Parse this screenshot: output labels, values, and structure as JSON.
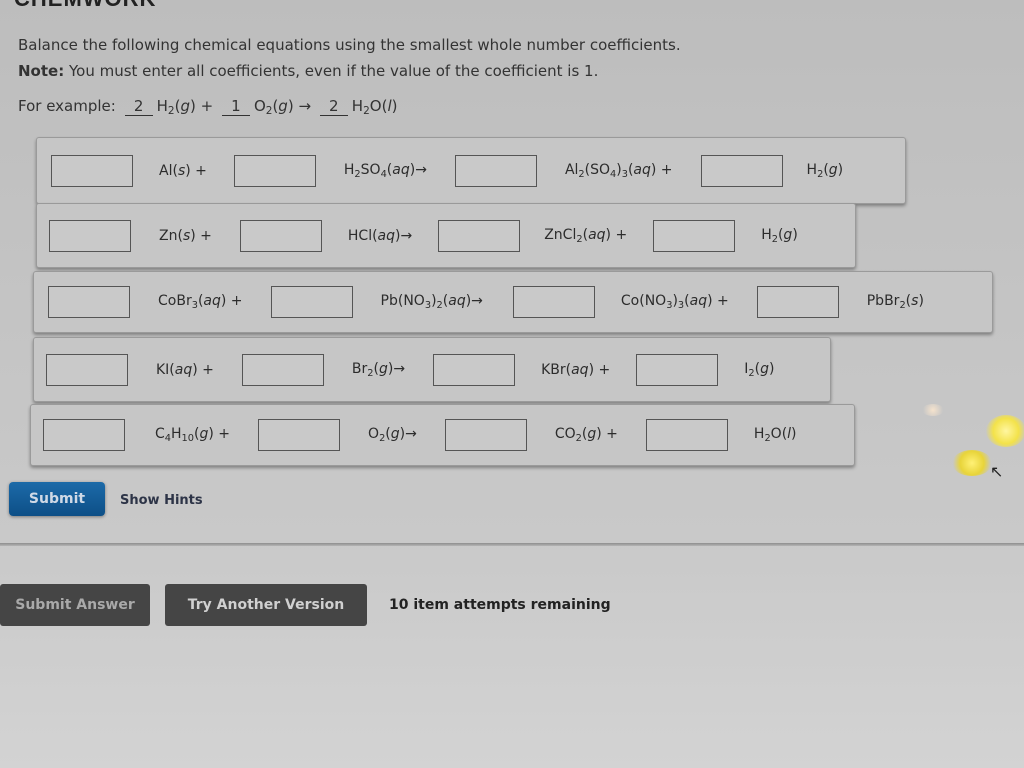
{
  "app": {
    "brand": "CHEMWORK"
  },
  "instructions": {
    "line1": "Balance the following chemical equations using the smallest whole number coefficients.",
    "note_label": "Note:",
    "note_text": " You must enter all coefficients, even if the value of the coefficient is 1."
  },
  "example": {
    "label": "For example:",
    "coef1": "2",
    "coef2": "1",
    "coef3": "2"
  },
  "equations": [
    {
      "coefficients": [
        "",
        "",
        "",
        ""
      ]
    },
    {
      "coefficients": [
        "",
        "",
        "",
        ""
      ]
    },
    {
      "coefficients": [
        "",
        "",
        "",
        ""
      ]
    },
    {
      "coefficients": [
        "",
        "",
        "",
        ""
      ]
    },
    {
      "coefficients": [
        "",
        "",
        "",
        ""
      ]
    }
  ],
  "actions": {
    "submit": "Submit",
    "show_hints": "Show Hints",
    "submit_answer": "Submit Answer",
    "try_another": "Try Another Version",
    "attempts_remaining": "10 item attempts remaining"
  },
  "colors": {
    "submit_blue": "#0d4f87",
    "dark_button": "#454545",
    "panel": "#c6c6c6"
  }
}
